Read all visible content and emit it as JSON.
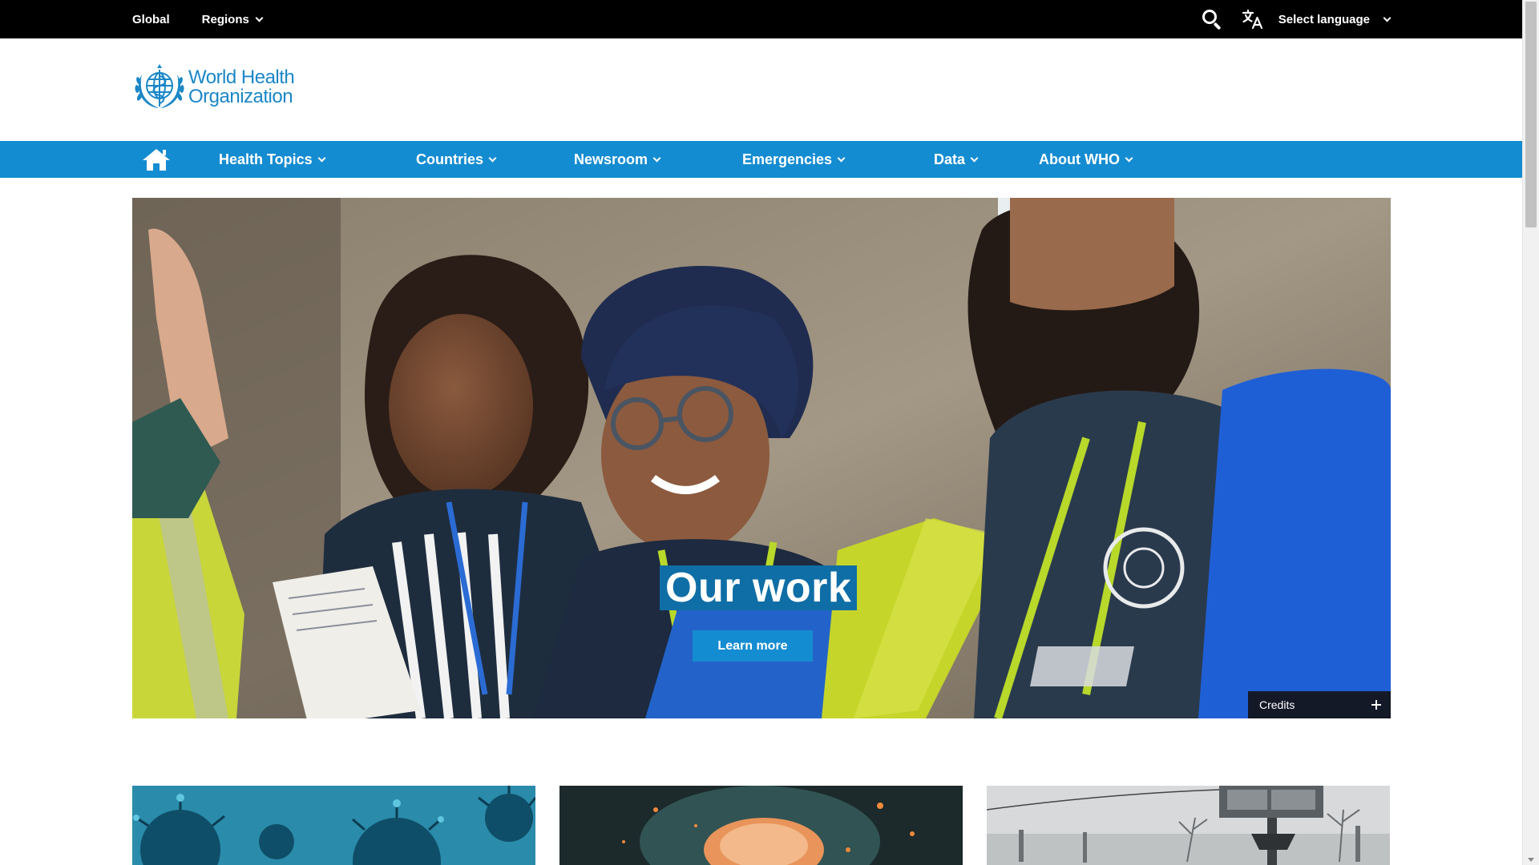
{
  "topbar": {
    "global_label": "Global",
    "regions_label": "Regions",
    "search_icon": "search-icon",
    "translate_icon": "translate-icon",
    "select_language_label": "Select language"
  },
  "logo": {
    "line1": "World Health",
    "line2": "Organization",
    "emblem_icon": "who-emblem-icon"
  },
  "nav": {
    "home_icon": "home-icon",
    "items": [
      {
        "label": "Health Topics"
      },
      {
        "label": "Countries"
      },
      {
        "label": "Newsroom"
      },
      {
        "label": "Emergencies"
      },
      {
        "label": "Data"
      },
      {
        "label": "About WHO"
      }
    ]
  },
  "hero": {
    "title": "Our work",
    "button_label": "Learn more",
    "credits_label": "Credits"
  },
  "cards": [
    {
      "image": "virus-illustration"
    },
    {
      "image": "particles-illustration"
    },
    {
      "image": "snowy-street-photo"
    }
  ],
  "colors": {
    "topbar_bg": "#000000",
    "nav_bg": "#148cd1",
    "brand_blue": "#1a87c7",
    "hero_title_bg": "#0f6ea5"
  }
}
